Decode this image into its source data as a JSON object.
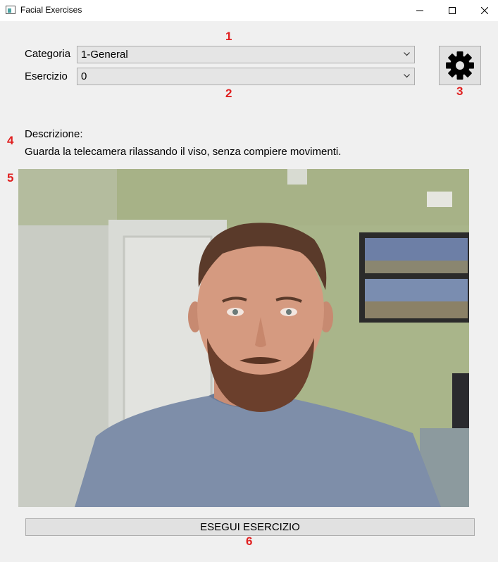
{
  "window": {
    "title": "Facial Exercises",
    "icon": "app-window-icon"
  },
  "annotations": {
    "a1": "1",
    "a2": "2",
    "a3": "3",
    "a4": "4",
    "a5": "5",
    "a6": "6",
    "color": "#e02020"
  },
  "form": {
    "categoria_label": "Categoria",
    "categoria_value": "1-General",
    "esercizio_label": "Esercizio",
    "esercizio_value": "0"
  },
  "settings": {
    "icon": "gear-icon"
  },
  "description": {
    "title": "Descrizione:",
    "text": "Guarda la telecamera rilassando il viso, senza compiere movimenti."
  },
  "camera": {
    "content": "webcam-feed"
  },
  "actions": {
    "run_label": "ESEGUI ESERCIZIO"
  }
}
